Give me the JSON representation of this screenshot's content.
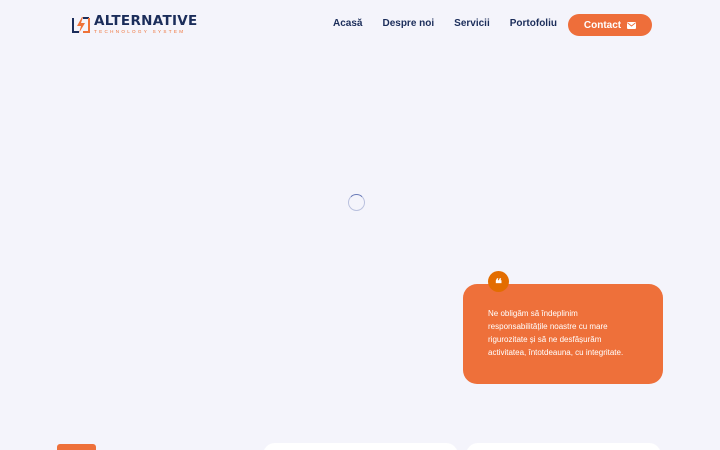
{
  "brand": {
    "title": "ALTERNATIVE",
    "subtitle": "TECHNOLOGY SYSTEM",
    "accent": "#ee6e3a",
    "navy": "#1b2d5a"
  },
  "nav": {
    "items": [
      {
        "label": "Acasă"
      },
      {
        "label": "Despre noi"
      },
      {
        "label": "Servicii"
      },
      {
        "label": "Portofoliu"
      }
    ],
    "contact_label": "Contact",
    "contact_icon": "envelope-icon"
  },
  "loader": {
    "icon": "spinner-icon"
  },
  "quote": {
    "icon": "quote-icon",
    "symbol": "❝",
    "text": "Ne obligăm să îndeplinim responsabilitățile noastre cu mare rigurozitate și să ne desfășurăm activitatea, întotdeauna, cu integritate."
  }
}
